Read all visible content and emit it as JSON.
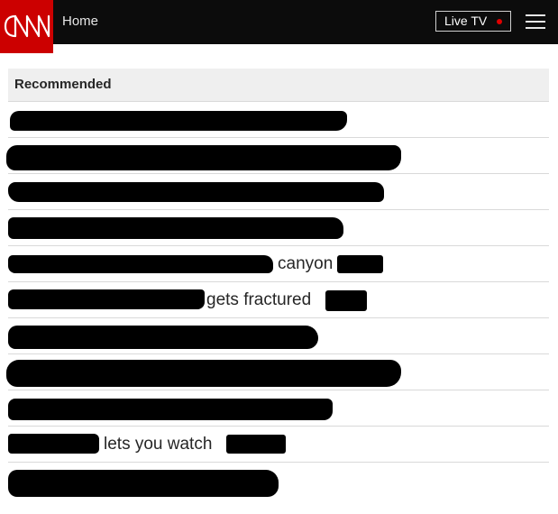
{
  "header": {
    "logo_text": "CNN",
    "home_label": "Home",
    "live_tv_label": "Live TV",
    "colors": {
      "bar": "#0c0c0c",
      "brand": "#cc0000",
      "live_dot": "#e00000"
    },
    "menu_icon": "hamburger-menu-icon"
  },
  "recommended": {
    "title": "Recommended",
    "items": [
      {
        "fragment": ""
      },
      {
        "fragment": ""
      },
      {
        "fragment": ""
      },
      {
        "fragment": ""
      },
      {
        "fragment": "canyon"
      },
      {
        "fragment": "gets fractured"
      },
      {
        "fragment": ""
      },
      {
        "fragment": ""
      },
      {
        "fragment": ""
      },
      {
        "fragment": "lets you watch"
      },
      {
        "fragment": ""
      }
    ]
  }
}
